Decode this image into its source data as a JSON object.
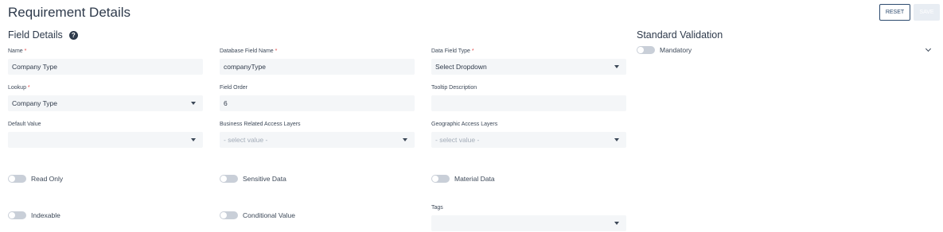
{
  "header": {
    "title": "Requirement Details",
    "reset_label": "RESET",
    "save_label": "SAVE"
  },
  "section": {
    "title": "Field Details",
    "help_icon": "question-circle-icon"
  },
  "fields": {
    "name": {
      "label": "Name",
      "value": "Company Type",
      "required": "*"
    },
    "db_field_name": {
      "label": "Database Field Name",
      "value": "companyType",
      "required": "*"
    },
    "data_field_type": {
      "label": "Data Field Type",
      "value": "Select Dropdown",
      "required": "*"
    },
    "lookup": {
      "label": "Lookup",
      "value": "Company Type",
      "required": "*"
    },
    "field_order": {
      "label": "Field Order",
      "value": "6"
    },
    "tooltip": {
      "label": "Tooltip Description",
      "value": ""
    },
    "default_value": {
      "label": "Default Value",
      "value": ""
    },
    "business_layers": {
      "label": "Business Related Access Layers",
      "placeholder": "- select value -"
    },
    "geo_layers": {
      "label": "Geographic Access Layers",
      "placeholder": "- select value -"
    },
    "tags": {
      "label": "Tags",
      "value": ""
    }
  },
  "toggles": {
    "read_only": "Read Only",
    "sensitive_data": "Sensitive Data",
    "material_data": "Material Data",
    "indexable": "Indexable",
    "conditional_value": "Conditional Value"
  },
  "validation": {
    "title": "Standard Validation",
    "mandatory_label": "Mandatory"
  },
  "colors": {
    "accent": "#2c4a6e",
    "required": "#e24b4b",
    "input_bg": "#f4f6f8",
    "toggle_off": "#c9cfd8"
  }
}
